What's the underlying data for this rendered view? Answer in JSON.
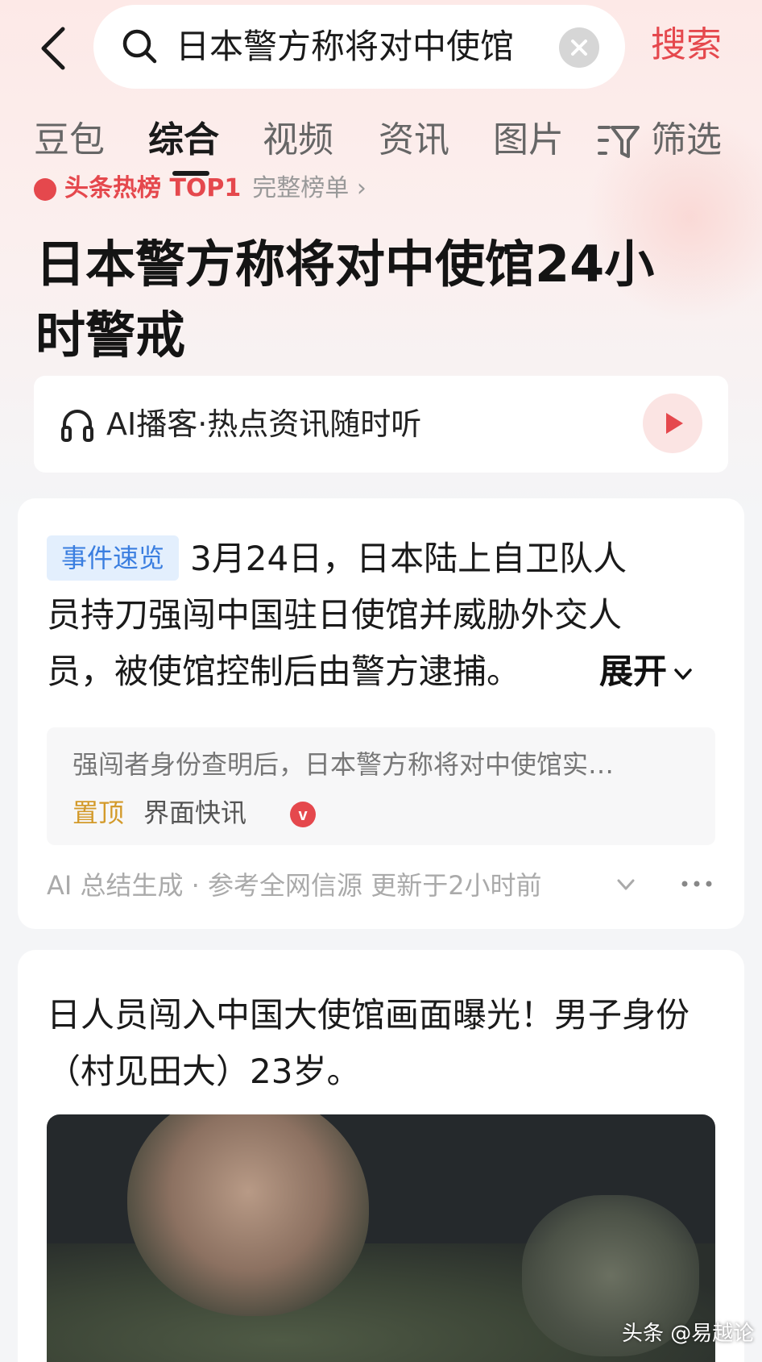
{
  "search": {
    "query": "日本警方称将对中使馆",
    "submit_label": "搜索"
  },
  "tabs": [
    {
      "label": "豆包",
      "active": false
    },
    {
      "label": "综合",
      "active": true
    },
    {
      "label": "视频",
      "active": false
    },
    {
      "label": "资讯",
      "active": false
    },
    {
      "label": "图片",
      "active": false
    }
  ],
  "filter_label": "筛选",
  "hot_rank": {
    "rank_text": "头条热榜 TOP1",
    "board_link": "完整榜单 ›"
  },
  "headline": "日本警方称将对中使馆24小时警戒",
  "podcast": {
    "label": "AI播客·热点资讯随时听"
  },
  "summary": {
    "badge": "事件速览",
    "line1": "3月24日，日本陆上自卫队人",
    "line2": "员持刀强闯中国驻日使馆并威胁外交人",
    "line3": "员，被使馆控制后由警方逮捕。",
    "expand_label": "展开",
    "quote": "强闯者身份查明后，日本警方称将对中使馆实…",
    "pin_label": "置顶",
    "source": "界面快讯",
    "verified_mark": "v",
    "footer": "AI 总结生成 · 参考全网信源 更新于2小时前"
  },
  "article": {
    "title": "日人员闯入中国大使馆画面曝光！男子身份（村见田大）23岁。"
  },
  "watermark": "头条 @易越论",
  "colors": {
    "accent_red": "#e5484d",
    "badge_blue": "#3a7ee0",
    "pin_gold": "#d39a2a"
  }
}
